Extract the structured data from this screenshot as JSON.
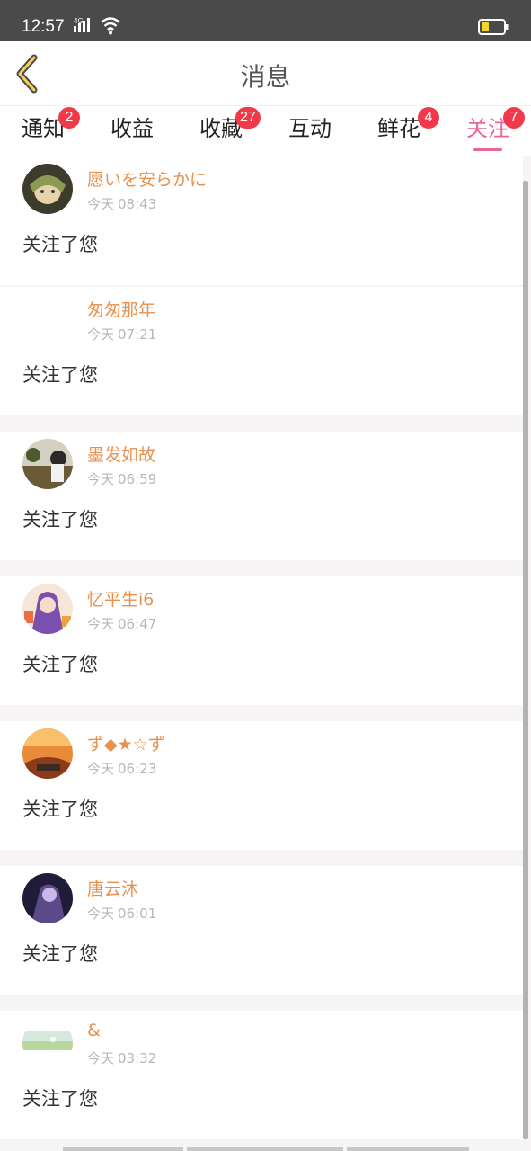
{
  "status_bar": {
    "time": "12:57",
    "network": "4G"
  },
  "header": {
    "title": "消息"
  },
  "tabs": [
    {
      "label": "通知",
      "badge": "2"
    },
    {
      "label": "收益",
      "badge": ""
    },
    {
      "label": "收藏",
      "badge": "27"
    },
    {
      "label": "互动",
      "badge": ""
    },
    {
      "label": "鲜花",
      "badge": "4"
    },
    {
      "label": "关注",
      "badge": "7",
      "active": true
    }
  ],
  "notifications": [
    {
      "username": "愿いを安らかに",
      "day": "今天",
      "time": "08:43",
      "action": "关注了您"
    },
    {
      "username": "匆匆那年",
      "day": "今天",
      "time": "07:21",
      "action": "关注了您"
    },
    {
      "username": "墨发如故",
      "day": "今天",
      "time": "06:59",
      "action": "关注了您"
    },
    {
      "username": "忆平生i6",
      "day": "今天",
      "time": "06:47",
      "action": "关注了您"
    },
    {
      "username": "ず◆★☆ず",
      "day": "今天",
      "time": "06:23",
      "action": "关注了您"
    },
    {
      "username": "唐云沐",
      "day": "今天",
      "time": "06:01",
      "action": "关注了您"
    },
    {
      "username": "&",
      "day": "今天",
      "time": "03:32",
      "action": "关注了您"
    }
  ],
  "colors": {
    "accent": "#e8649a",
    "username": "#e8914f",
    "badge": "#f2394a"
  }
}
